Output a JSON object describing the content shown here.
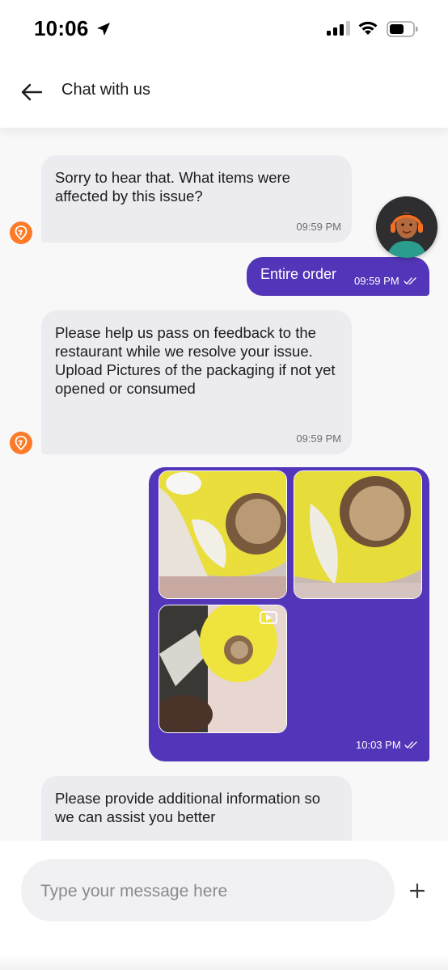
{
  "status_bar": {
    "time": "10:06",
    "icons": [
      "location-arrow-icon",
      "cellular-signal-icon",
      "wifi-icon",
      "battery-icon"
    ]
  },
  "header": {
    "title": "Chat with us",
    "back_icon": "back-arrow-icon"
  },
  "messages": [
    {
      "sender": "bot",
      "text": "Sorry to hear that. What items were affected by this issue?",
      "time": "09:59 PM"
    },
    {
      "sender": "user",
      "text": "Entire order",
      "time": "09:59 PM",
      "status": "read"
    },
    {
      "sender": "bot",
      "text": "Please help us pass on feedback to the restaurant while we resolve your issue. Upload Pictures of the packaging if not yet opened or consumed",
      "time": "09:59 PM"
    },
    {
      "sender": "user",
      "type": "media",
      "items": [
        "photo",
        "photo",
        "video"
      ],
      "time": "10:03 PM",
      "status": "read"
    },
    {
      "sender": "bot",
      "text": "Please provide additional information so we can assist you better"
    }
  ],
  "input": {
    "placeholder": "Type your message here",
    "value": "",
    "add_icon": "plus-icon"
  },
  "colors": {
    "accent": "#5235b8",
    "bot_bubble": "#ececf0",
    "brand_orange": "#fc7a28",
    "background": "#f8f8f9"
  }
}
